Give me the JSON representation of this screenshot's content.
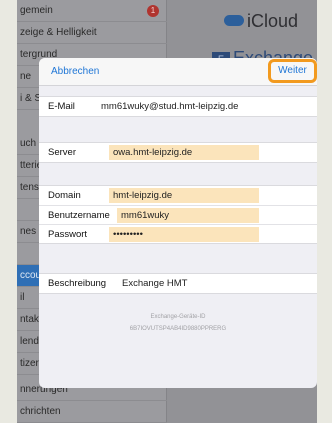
{
  "settings_sidebar": {
    "items": [
      {
        "label": "gemein",
        "badge": "1"
      },
      {
        "label": "zeige & Helligkeit"
      },
      {
        "label": "tergrund"
      },
      {
        "label": "ne"
      },
      {
        "label": "i & S"
      },
      {
        "label": "uch I"
      },
      {
        "label": "tterie"
      },
      {
        "label": "tensc"
      },
      {
        "label": ""
      },
      {
        "label": "nes"
      },
      {
        "label": ""
      },
      {
        "label": "ccou",
        "selected": true
      },
      {
        "label": "il"
      },
      {
        "label": "ntakt"
      },
      {
        "label": "lend"
      },
      {
        "label": "tizer"
      },
      {
        "label": "nnerungen"
      },
      {
        "label": "chrichten"
      }
    ]
  },
  "background": {
    "icloud_label": "iCloud",
    "exchange_label": "Exchange",
    "exchange_icon_text": "E"
  },
  "modal": {
    "cancel_label": "Abbrechen",
    "next_label": "Weiter",
    "email_label": "E-Mail",
    "email_value": "mm61wuky@stud.hmt-leipzig.de",
    "server_label": "Server",
    "server_value": "owa.hmt-leipzig.de",
    "domain_label": "Domain",
    "domain_value": "hmt-leipzig.de",
    "username_label": "Benutzername",
    "username_value": "mm61wuky",
    "password_label": "Passwort",
    "password_value": "•••••••••",
    "description_label": "Beschreibung",
    "description_value": "Exchange HMT",
    "device_id_label": "Exchange-Geräte-ID",
    "device_id_value": "6B7IOVUTSP4AB4ID9880PPRERG"
  },
  "colors": {
    "accent": "#1f76d6",
    "highlight_outline": "#f29a1f",
    "field_highlight": "#fbe4bb"
  }
}
